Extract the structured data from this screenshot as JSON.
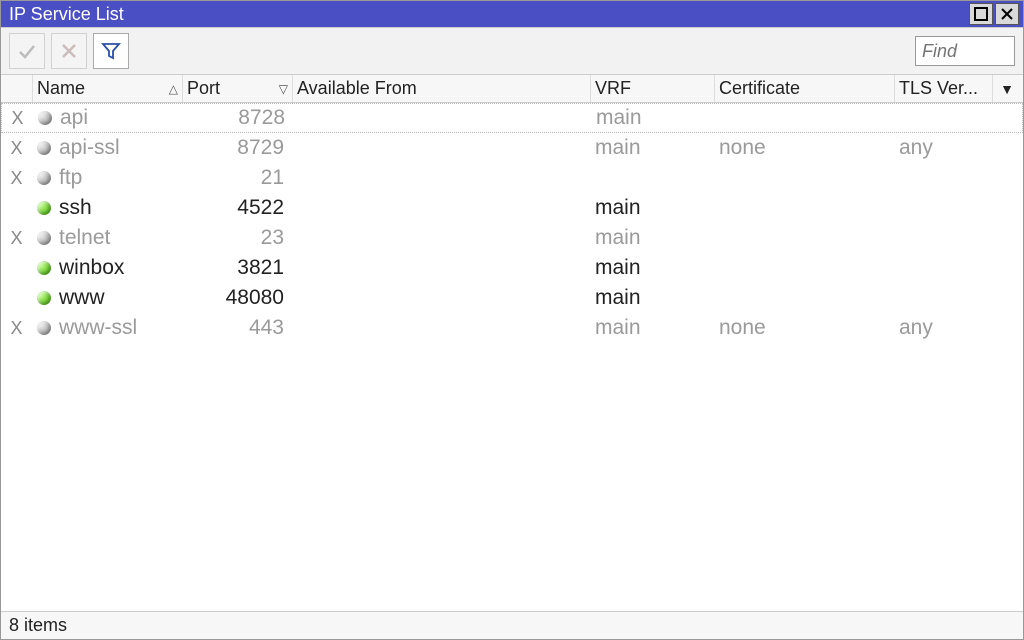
{
  "window": {
    "title": "IP Service List"
  },
  "toolbar": {
    "find_placeholder": "Find"
  },
  "columns": {
    "name": "Name",
    "port": "Port",
    "available_from": "Available From",
    "vrf": "VRF",
    "certificate": "Certificate",
    "tls_version": "TLS Ver..."
  },
  "rows": [
    {
      "disabled": true,
      "marker": "X",
      "dot": "gray",
      "name": "api",
      "port": "8728",
      "available_from": "",
      "vrf": "main",
      "certificate": "",
      "tls": ""
    },
    {
      "disabled": true,
      "marker": "X",
      "dot": "gray",
      "name": "api-ssl",
      "port": "8729",
      "available_from": "",
      "vrf": "main",
      "certificate": "none",
      "tls": "any"
    },
    {
      "disabled": true,
      "marker": "X",
      "dot": "gray",
      "name": "ftp",
      "port": "21",
      "available_from": "",
      "vrf": "",
      "certificate": "",
      "tls": ""
    },
    {
      "disabled": false,
      "marker": "",
      "dot": "green",
      "name": "ssh",
      "port": "4522",
      "available_from": "",
      "vrf": "main",
      "certificate": "",
      "tls": ""
    },
    {
      "disabled": true,
      "marker": "X",
      "dot": "gray",
      "name": "telnet",
      "port": "23",
      "available_from": "",
      "vrf": "main",
      "certificate": "",
      "tls": ""
    },
    {
      "disabled": false,
      "marker": "",
      "dot": "green",
      "name": "winbox",
      "port": "3821",
      "available_from": "",
      "vrf": "main",
      "certificate": "",
      "tls": ""
    },
    {
      "disabled": false,
      "marker": "",
      "dot": "green",
      "name": "www",
      "port": "48080",
      "available_from": "",
      "vrf": "main",
      "certificate": "",
      "tls": ""
    },
    {
      "disabled": true,
      "marker": "X",
      "dot": "gray",
      "name": "www-ssl",
      "port": "443",
      "available_from": "",
      "vrf": "main",
      "certificate": "none",
      "tls": "any"
    }
  ],
  "statusbar": {
    "count_label": "8 items"
  }
}
